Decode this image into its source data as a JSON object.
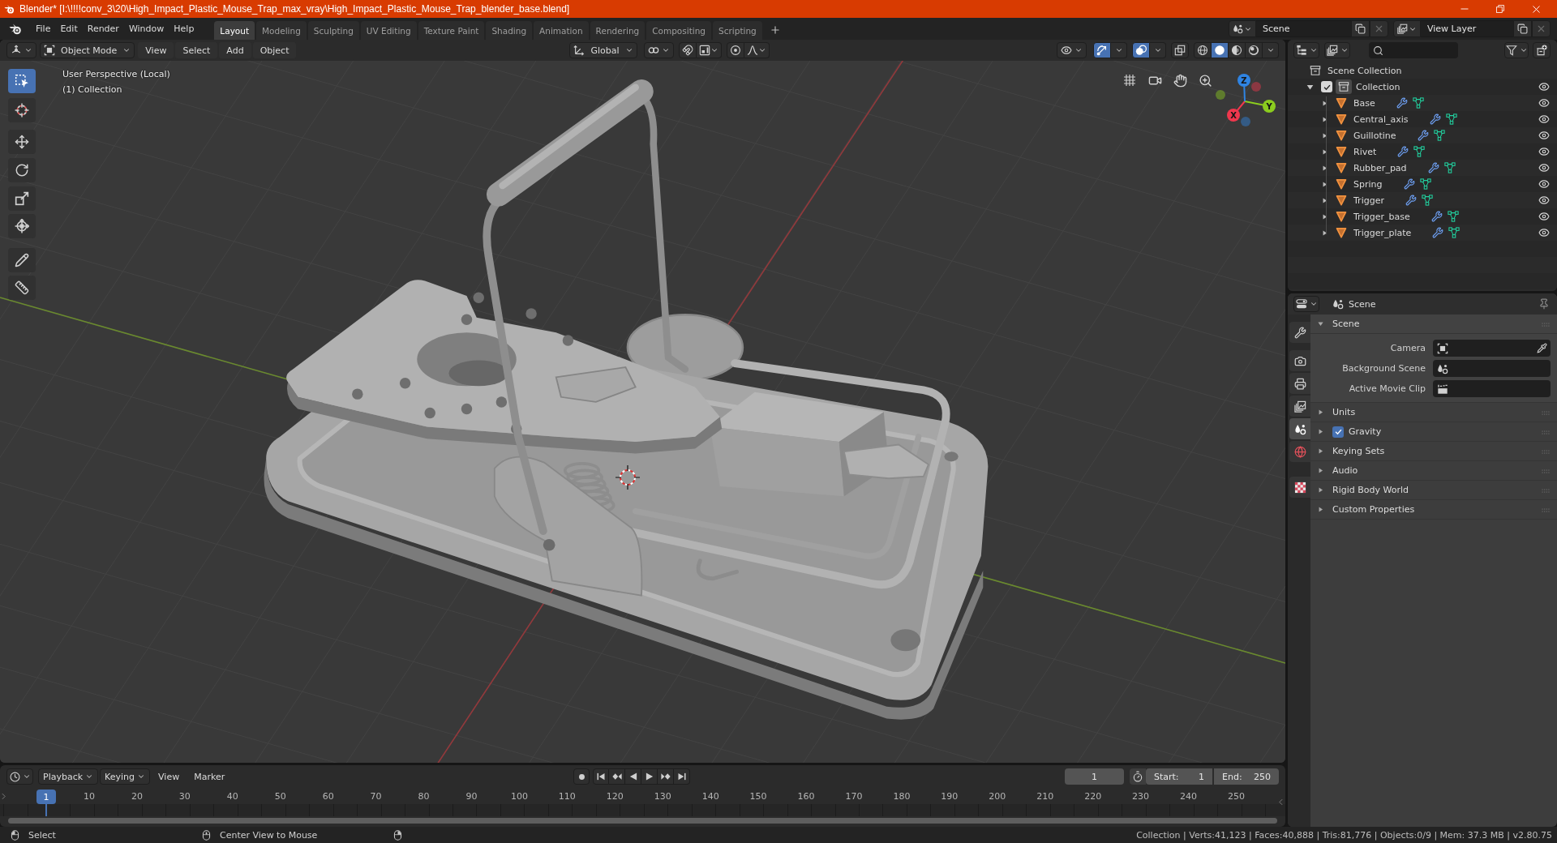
{
  "window": {
    "title": "Blender* [I:\\!!!!conv_3\\20\\High_Impact_Plastic_Mouse_Trap_max_vray\\High_Impact_Plastic_Mouse_Trap_blender_base.blend]"
  },
  "menu": [
    "File",
    "Edit",
    "Render",
    "Window",
    "Help"
  ],
  "workspaces": [
    {
      "label": "Layout",
      "selected": true
    },
    {
      "label": "Modeling",
      "selected": false
    },
    {
      "label": "Sculpting",
      "selected": false
    },
    {
      "label": "UV Editing",
      "selected": false
    },
    {
      "label": "Texture Paint",
      "selected": false
    },
    {
      "label": "Shading",
      "selected": false
    },
    {
      "label": "Animation",
      "selected": false
    },
    {
      "label": "Rendering",
      "selected": false
    },
    {
      "label": "Compositing",
      "selected": false
    },
    {
      "label": "Scripting",
      "selected": false
    }
  ],
  "scene_field": {
    "value": "Scene"
  },
  "view_layer_field": {
    "value": "View Layer"
  },
  "viewport": {
    "mode": "Object Mode",
    "menus": [
      "View",
      "Select",
      "Add",
      "Object"
    ],
    "orientation": "Global",
    "gizmos": true,
    "overlays": true,
    "xray": false,
    "shading": [
      {
        "kind": "wireframe",
        "selected": false
      },
      {
        "kind": "solid",
        "selected": true
      },
      {
        "kind": "material",
        "selected": false
      },
      {
        "kind": "rendered",
        "selected": false
      }
    ],
    "tools": [
      {
        "kind": "select",
        "selected": true
      },
      {
        "kind": "cursor",
        "selected": false
      },
      {
        "kind": "move",
        "selected": false
      },
      {
        "kind": "rotate",
        "selected": false
      },
      {
        "kind": "scale",
        "selected": false
      },
      {
        "kind": "transform",
        "selected": false
      },
      {
        "kind": "annotate",
        "selected": false
      },
      {
        "kind": "measure",
        "selected": false
      }
    ],
    "info": [
      "User Perspective (Local)",
      "(1) Collection"
    ],
    "gizmo_axes": [
      {
        "label": "X",
        "color": "#f0374d"
      },
      {
        "label": "Y",
        "color": "#8bcc1f"
      },
      {
        "label": "Z",
        "color": "#2f84e3"
      }
    ]
  },
  "outliner": {
    "root": "Scene Collection",
    "collections": [
      {
        "name": "Collection",
        "checked": true,
        "expanded": true,
        "active": true,
        "visible": true,
        "children": [
          {
            "name": "Base",
            "expanded": false,
            "visible": true
          },
          {
            "name": "Central_axis",
            "expanded": false,
            "visible": true
          },
          {
            "name": "Guillotine",
            "expanded": false,
            "visible": true
          },
          {
            "name": "Rivet",
            "expanded": false,
            "visible": true
          },
          {
            "name": "Rubber_pad",
            "expanded": false,
            "visible": true
          },
          {
            "name": "Spring",
            "expanded": false,
            "visible": true
          },
          {
            "name": "Trigger",
            "expanded": false,
            "visible": true
          },
          {
            "name": "Trigger_base",
            "expanded": false,
            "visible": true
          },
          {
            "name": "Trigger_plate",
            "expanded": false,
            "visible": true
          }
        ]
      }
    ]
  },
  "properties": {
    "context": "Scene",
    "tabs": [
      {
        "kind": "tool",
        "selected": false
      },
      {
        "kind": "render",
        "selected": false
      },
      {
        "kind": "output",
        "selected": false
      },
      {
        "kind": "view_layer",
        "selected": false
      },
      {
        "kind": "scene",
        "selected": true
      },
      {
        "kind": "world",
        "selected": false
      },
      {
        "kind": "texture",
        "selected": false
      }
    ],
    "panels": [
      {
        "title": "Scene",
        "kind": "plain",
        "expanded": true,
        "fields": [
          {
            "label": "Camera",
            "kind": "object"
          },
          {
            "label": "Background Scene",
            "kind": "scene"
          },
          {
            "label": "Active Movie Clip",
            "kind": "clip"
          }
        ]
      },
      {
        "title": "Units",
        "kind": "plain",
        "expanded": false
      },
      {
        "title": "Gravity",
        "kind": "toggle",
        "checked": true,
        "expanded": false
      },
      {
        "title": "Keying Sets",
        "kind": "plain",
        "expanded": false
      },
      {
        "title": "Audio",
        "kind": "plain",
        "expanded": false
      },
      {
        "title": "Rigid Body World",
        "kind": "plain",
        "expanded": false
      },
      {
        "title": "Custom Properties",
        "kind": "plain",
        "expanded": false
      }
    ]
  },
  "timeline": {
    "menus": [
      {
        "label": "Playback",
        "kind": "dropdown"
      },
      {
        "label": "Keying",
        "kind": "dropdown"
      },
      {
        "label": "View",
        "kind": "menu"
      },
      {
        "label": "Marker",
        "kind": "menu"
      }
    ],
    "current_frame": "1",
    "start": {
      "label": "Start:",
      "value": "1"
    },
    "end": {
      "label": "End:",
      "value": "250"
    },
    "playhead": "1",
    "ruler": [
      "10",
      "20",
      "30",
      "40",
      "50",
      "60",
      "70",
      "80",
      "90",
      "100",
      "110",
      "120",
      "130",
      "140",
      "150",
      "160",
      "170",
      "180",
      "190",
      "200",
      "210",
      "220",
      "230",
      "240",
      "250"
    ]
  },
  "status_bar": {
    "hints": [
      {
        "kind": "left",
        "label": "Select"
      },
      {
        "kind": "middle",
        "label": "Center View to Mouse"
      },
      {
        "kind": "right"
      }
    ],
    "stats": "Collection | Verts:41,123 | Faces:40,888 | Tris:81,776 | Objects:0/9 | Mem: 37.3 MB | v2.80.75"
  }
}
